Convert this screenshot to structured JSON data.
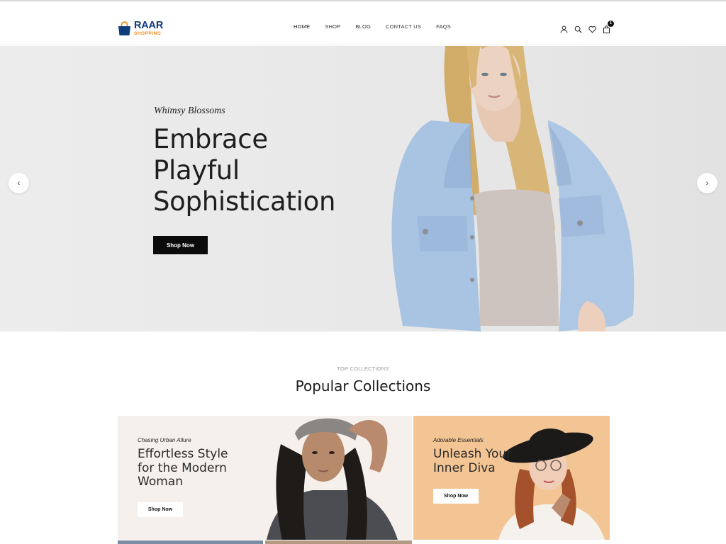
{
  "brand": {
    "name_line1": "RAAR",
    "name_line2": "SHOPPING"
  },
  "nav": {
    "items": [
      "HOME",
      "SHOP",
      "BLOG",
      "CONTACT US",
      "FAQS"
    ],
    "active": "HOME"
  },
  "header_icons": {
    "icons": [
      "user-icon",
      "search-icon",
      "heart-icon",
      "bag-icon"
    ],
    "cart_count": "1"
  },
  "hero": {
    "eyebrow": "Whimsy Blossoms",
    "title_lines": [
      "Embrace",
      "Playful",
      "Sophistication"
    ],
    "cta_label": "Shop Now",
    "prev_arrow": "‹",
    "next_arrow": "›"
  },
  "collections": {
    "eyebrow": "TOP COLLECTIONS",
    "title": "Popular Collections",
    "cards": [
      {
        "eyebrow": "Chasing Urban Allure",
        "title_lines": [
          "Effortless Style",
          "for the Modern",
          "Woman"
        ],
        "cta_label": "Shop Now"
      },
      {
        "eyebrow": "Adorable Essentials",
        "title_lines": [
          "Unleash Your",
          "Inner Diva"
        ],
        "cta_label": "Shop Now"
      }
    ]
  },
  "colors": {
    "brand_blue": "#0d3d7a",
    "brand_orange": "#ef8b1f",
    "button_dark": "#0b0b0b",
    "card2_bg": "#f3c594"
  }
}
